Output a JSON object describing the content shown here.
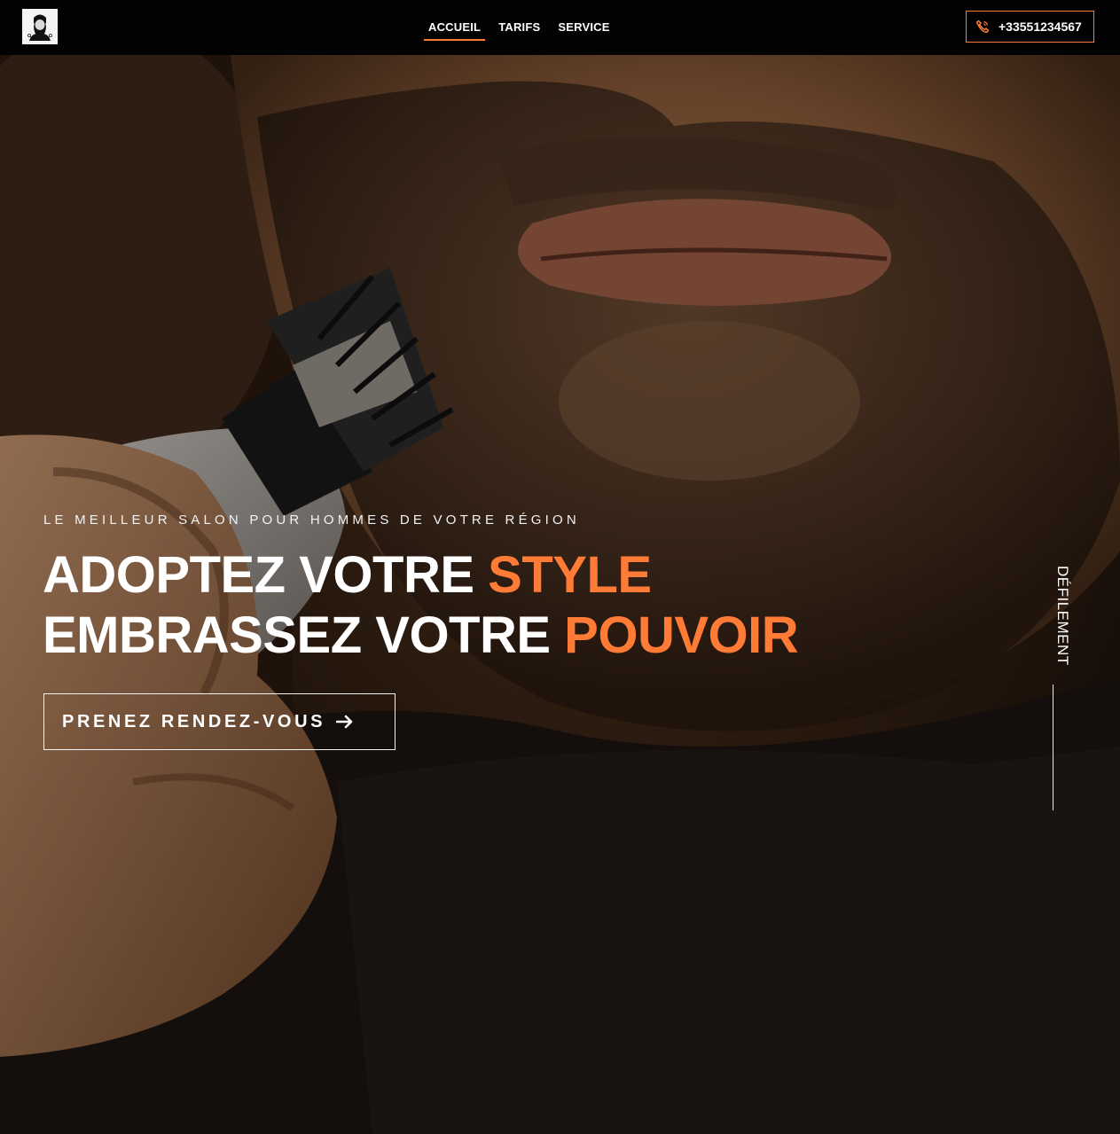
{
  "header": {
    "nav": [
      {
        "label": "ACCUEIL",
        "active": true
      },
      {
        "label": "TARIFS",
        "active": false
      },
      {
        "label": "SERVICE",
        "active": false
      }
    ],
    "phone": "+33551234567",
    "icons": {
      "logo": "bearded-man-logo-icon",
      "phone": "phone-icon"
    }
  },
  "hero": {
    "tagline": "LE MEILLEUR SALON POUR HOMMES DE VOTRE RÉGION",
    "line1_prefix": "ADOPTEZ VOTRE ",
    "line1_accent": "STYLE",
    "line2_prefix": "EMBRASSEZ VOTRE ",
    "line2_accent": "POUVOIR",
    "cta_label": "PRENEZ RENDEZ-VOUS",
    "scroll_label": "DÉFILEMENT",
    "icons": {
      "cta": "arrow-right-icon"
    }
  },
  "colors": {
    "accent": "#ff7b36",
    "topbar": "#020202",
    "text": "#ffffff"
  }
}
